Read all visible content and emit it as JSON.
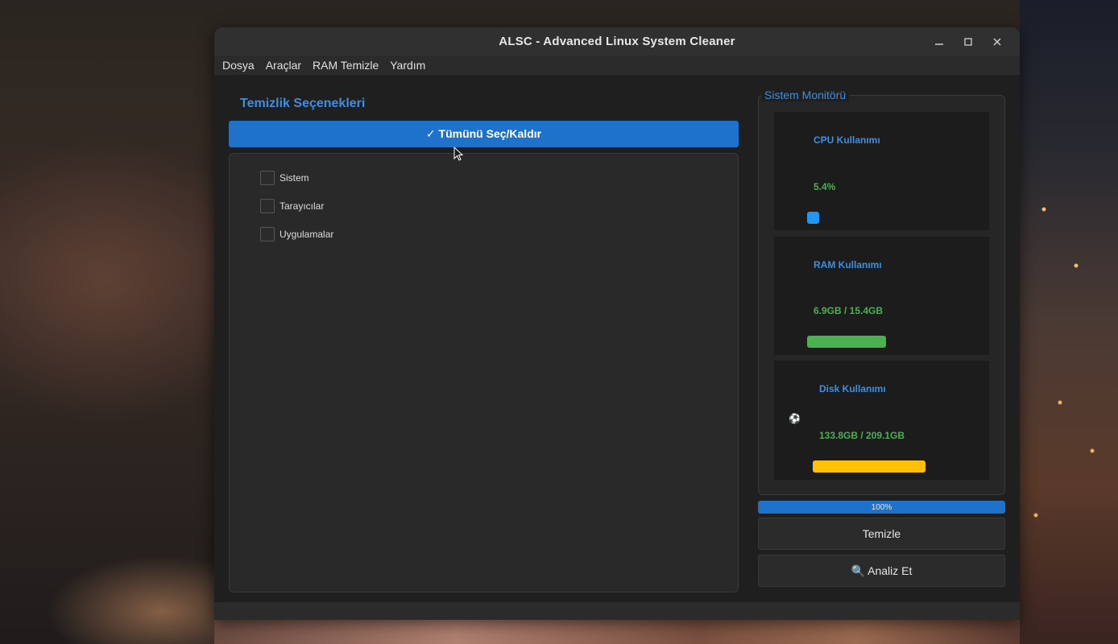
{
  "window": {
    "title": "ALSC - Advanced Linux System Cleaner",
    "controls": [
      "minimize-icon",
      "maximize-icon",
      "close-icon"
    ]
  },
  "menu": [
    "Dosya",
    "Araçlar",
    "RAM Temizle",
    "Yardım"
  ],
  "options": {
    "title": " Temizlik Seçenekleri",
    "select_all": "✓ Tümünü Seç/Kaldır",
    "items": [
      {
        "label": " Sistem",
        "checked": false
      },
      {
        "label": " Tarayıcılar",
        "checked": false
      },
      {
        "label": " Uygulamalar",
        "checked": false
      }
    ]
  },
  "monitor": {
    "title": "Sistem Monitörü",
    "cpu": {
      "title": "CPU Kullanımı",
      "value": "5.4%",
      "icon": "",
      "bar_color": "#2196f3",
      "fraction": 0.054
    },
    "ram": {
      "title": "RAM Kullanımı",
      "value": "6.9GB / 15.4GB",
      "icon": "",
      "bar_color": "#4caf50",
      "fraction": 0.448
    },
    "disk": {
      "title": "Disk Kullanımı",
      "value": "133.8GB / 209.1GB",
      "icon": "⚽",
      "bar_color": "#ffc107",
      "fraction": 0.64
    }
  },
  "progress": {
    "label": "100%",
    "value": 1.0
  },
  "actions": {
    "clean": " Temizle",
    "analyze": "🔍 Analiz Et"
  }
}
